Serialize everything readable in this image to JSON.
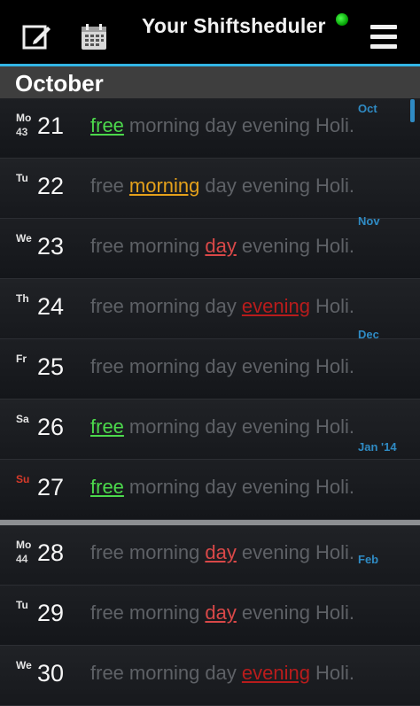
{
  "app": {
    "title": "Your Shiftsheduler",
    "accent_color": "#33b5e5",
    "status_color": "#33dd33"
  },
  "toolbar": {
    "edit_icon": "edit-icon",
    "calendar_icon": "calendar-icon",
    "menu_icon": "menu-icon"
  },
  "month_header": "October",
  "shift_labels": [
    "free",
    "morning",
    "day",
    "evening",
    "Holi."
  ],
  "days": [
    {
      "weekday": "Mo",
      "week": "43",
      "day": "21",
      "active": "free"
    },
    {
      "weekday": "Tu",
      "week": "",
      "day": "22",
      "active": "morning"
    },
    {
      "weekday": "We",
      "week": "",
      "day": "23",
      "active": "day"
    },
    {
      "weekday": "Th",
      "week": "",
      "day": "24",
      "active": "evening"
    },
    {
      "weekday": "Fr",
      "week": "",
      "day": "25",
      "active": ""
    },
    {
      "weekday": "Sa",
      "week": "",
      "day": "26",
      "active": "free"
    },
    {
      "weekday": "Su",
      "week": "",
      "day": "27",
      "active": "free"
    },
    {
      "weekday": "Mo",
      "week": "44",
      "day": "28",
      "active": "day"
    },
    {
      "weekday": "Tu",
      "week": "",
      "day": "29",
      "active": "day"
    },
    {
      "weekday": "We",
      "week": "",
      "day": "30",
      "active": "evening"
    }
  ],
  "month_scroller": [
    "Oct",
    "Nov",
    "Dec",
    "Jan '14",
    "Feb"
  ]
}
